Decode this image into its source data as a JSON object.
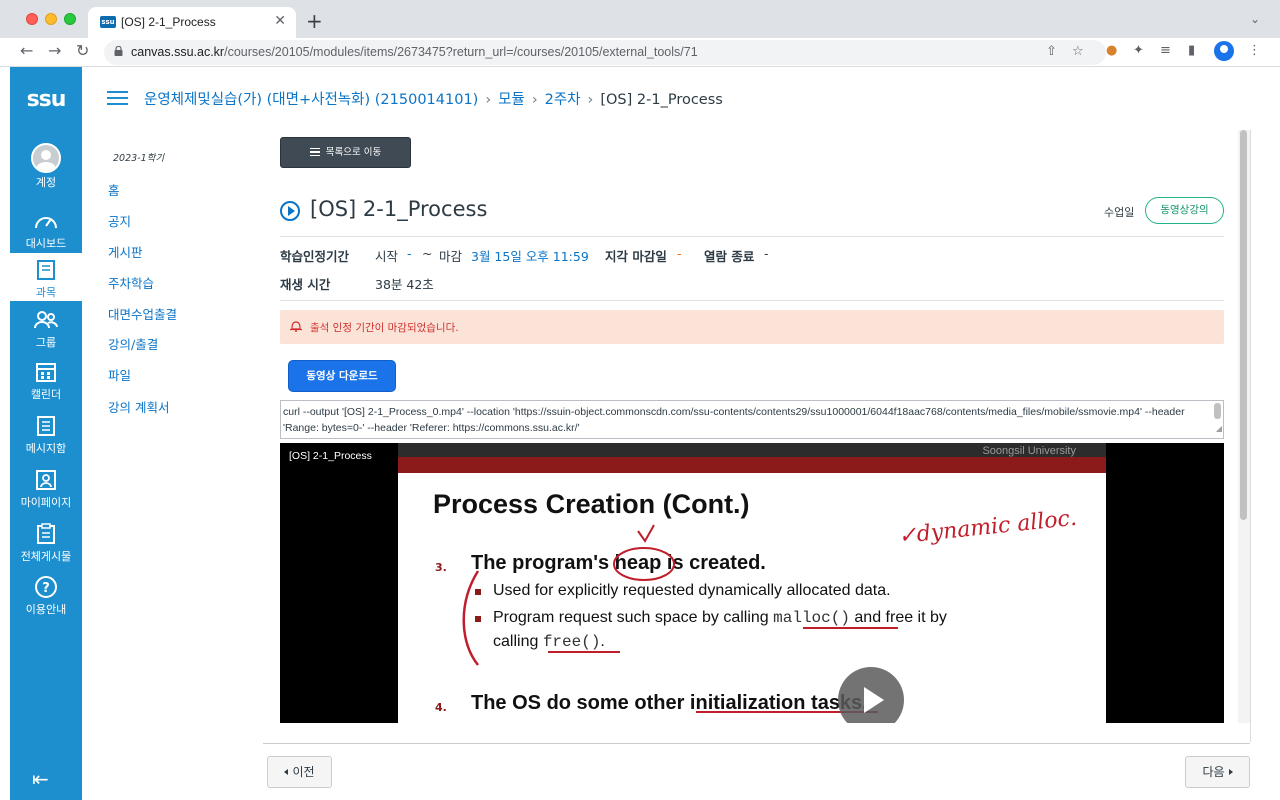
{
  "browser": {
    "tab_title": "[OS] 2-1_Process",
    "tab_favicon": "ssu",
    "url_host": "canvas.ssu.ac.kr",
    "url_path": "/courses/20105/modules/items/2673475?return_url=/courses/20105/external_tools/71"
  },
  "gnav": {
    "logo": "ssu",
    "items": [
      {
        "label": "계정",
        "icon": "account-avatar-icon"
      },
      {
        "label": "대시보드",
        "icon": "dashboard-icon"
      },
      {
        "label": "과목",
        "icon": "courses-icon"
      },
      {
        "label": "그룹",
        "icon": "groups-icon"
      },
      {
        "label": "캘린더",
        "icon": "calendar-icon"
      },
      {
        "label": "메시지함",
        "icon": "inbox-icon"
      },
      {
        "label": "마이페이지",
        "icon": "mypage-icon"
      },
      {
        "label": "전체게시물",
        "icon": "all-posts-icon"
      },
      {
        "label": "이용안내",
        "icon": "help-icon"
      }
    ],
    "active": "과목"
  },
  "breadcrumbs": {
    "course": "운영체제및실습(가) (대면+사전녹화) (2150014101)",
    "modules": "모듈",
    "week": "2주차",
    "current": "[OS] 2-1_Process"
  },
  "course_nav": {
    "term": "2023-1학기",
    "items": [
      "홈",
      "공지",
      "게시판",
      "주차학습",
      "대면수업출결",
      "강의/출결",
      "파일",
      "강의 계획서"
    ]
  },
  "content": {
    "list_button": "목록으로 이동",
    "title": "[OS] 2-1_Process",
    "class_date_label": "수업일",
    "type_badge": "동영상강의",
    "period_label": "학습인정기간",
    "start_label": "시작",
    "start_value": "-",
    "tilde": "~",
    "due_label": "마감",
    "due_value": "3월 15일 오후 11:59",
    "late_label": "지각 마감일",
    "late_value": "-",
    "close_label": "열람 종료",
    "close_value": "-",
    "duration_label": "재생 시간",
    "duration_value": "38분 42초",
    "alert": "출석 인정 기간이 마감되었습니다.",
    "download_button": "동영상 다운로드",
    "curl_text": "curl --output '[OS] 2-1_Process_0.mp4' --location 'https://ssuin-object.commonscdn.com/ssu-contents/contents29/ssu1000001/6044f18aac768/contents/media_files/mobile/ssmovie.mp4' --header 'Range: bytes=0-' --header 'Referer: https://commons.ssu.ac.kr/'"
  },
  "video": {
    "title": "[OS] 2-1_Process",
    "slide_org": "Soongsil University",
    "slide_title": "Process Creation (Cont.)",
    "item3_num": "3.",
    "item3": "The program's heap is created.",
    "bullet1": "Used for explicitly requested dynamically allocated data.",
    "bullet2_a": "Program request such space by calling ",
    "bullet2_code": "malloc()",
    "bullet2_b": " and free it by",
    "bullet2_c": "calling ",
    "bullet2_code2": "free()",
    "bullet2_d": ".",
    "item4_num": "4.",
    "item4": "The OS do some other initialization tasks.",
    "annotation": "✓dynamic alloc."
  },
  "footer": {
    "prev": "이전",
    "next": "다음"
  }
}
